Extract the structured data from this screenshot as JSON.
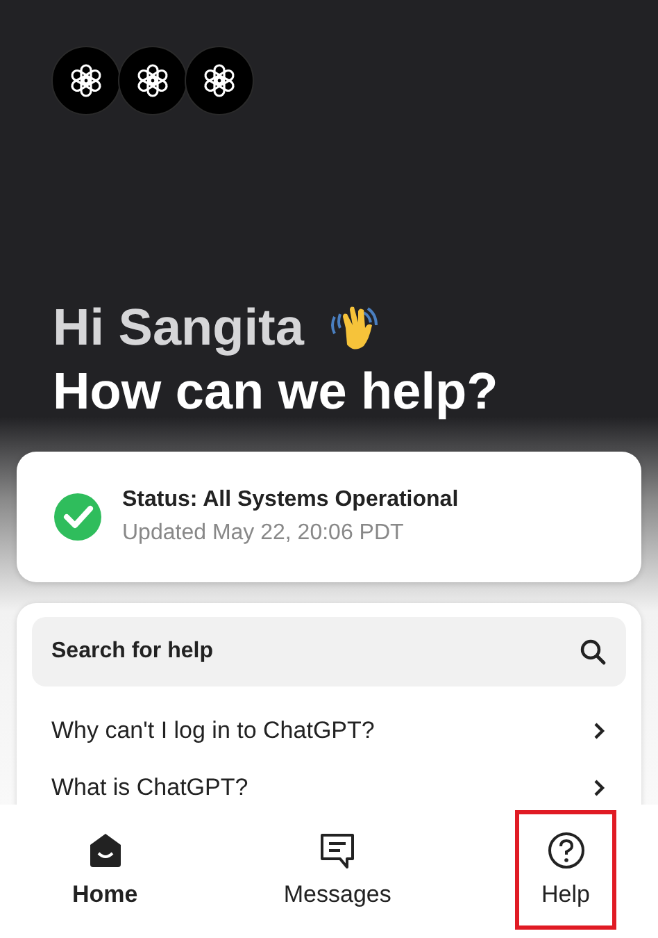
{
  "avatars": [
    {
      "kind": "logo"
    },
    {
      "kind": "logo"
    },
    {
      "kind": "logo"
    }
  ],
  "greeting": {
    "line1": "Hi Sangita",
    "line2": "How can we help?"
  },
  "status": {
    "ok": true,
    "title": "Status: All Systems Operational",
    "updated": "Updated May 22, 20:06 PDT"
  },
  "help": {
    "search": {
      "placeholder": "Search for help"
    },
    "articles": [
      "Why can't I log in to ChatGPT?",
      "What is ChatGPT?"
    ]
  },
  "nav": [
    {
      "label": "Home",
      "kind": "home",
      "selected": true,
      "highlighted": false
    },
    {
      "label": "Messages",
      "kind": "messages",
      "selected": false,
      "highlighted": false
    },
    {
      "label": "Help",
      "kind": "help",
      "selected": false,
      "highlighted": true
    }
  ]
}
